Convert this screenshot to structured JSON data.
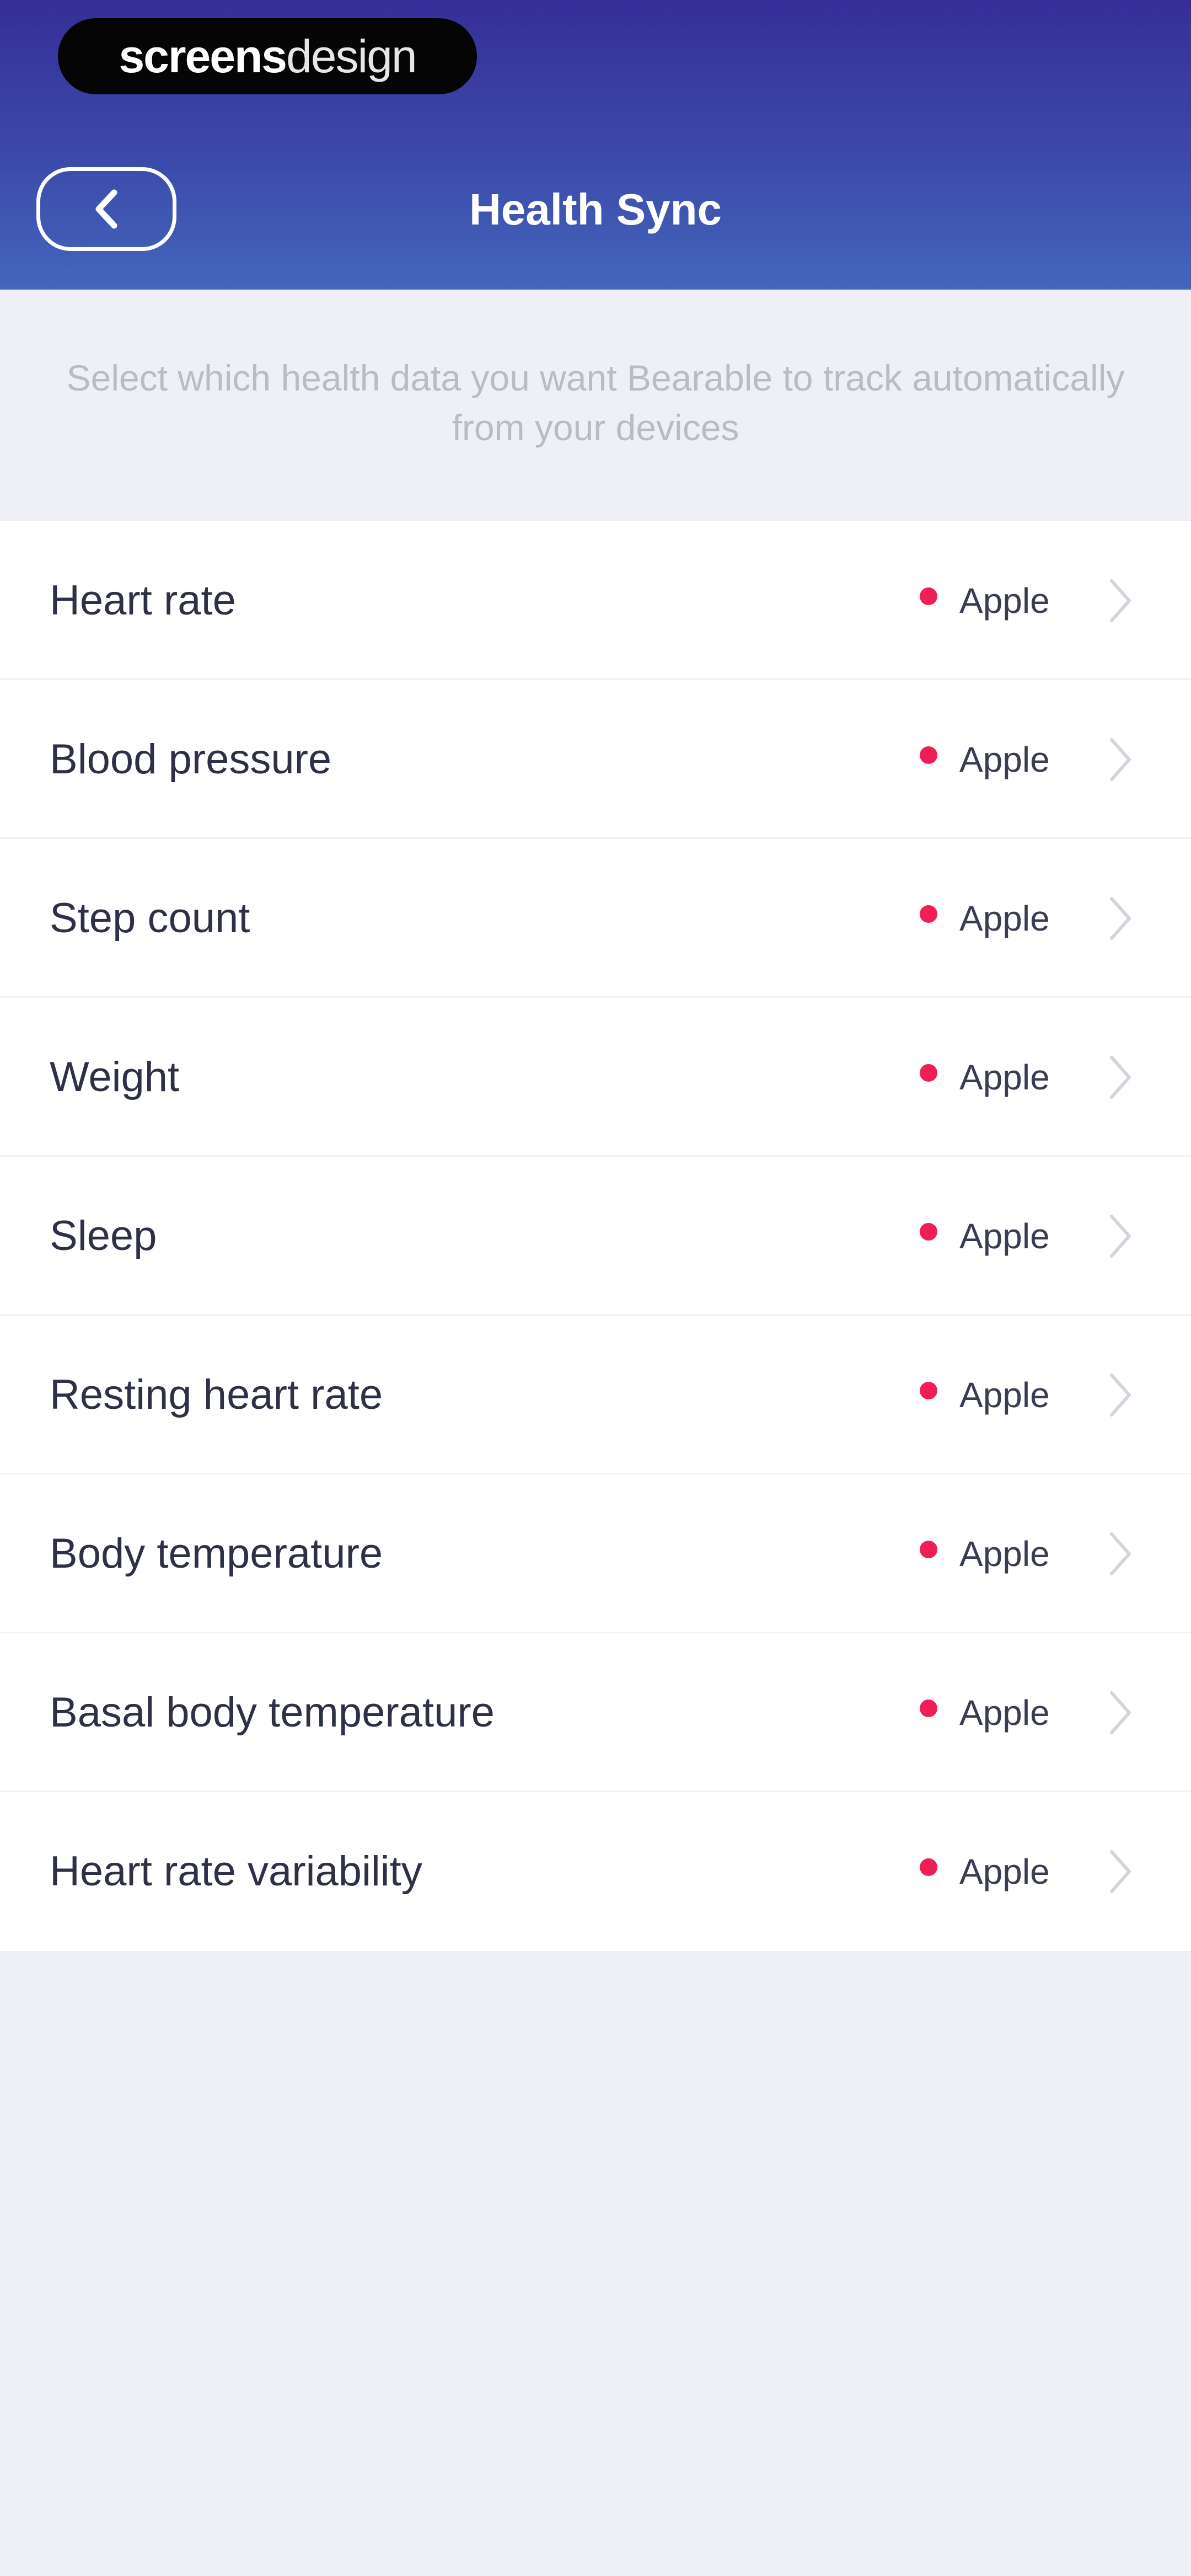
{
  "watermark": {
    "bold": "screens",
    "light": "design"
  },
  "header": {
    "title": "Health Sync",
    "back_icon": "chevron-left-icon"
  },
  "description": "Select which health data you want Bearable to track automatically from your devices",
  "colors": {
    "header_top": "#362e98",
    "header_bottom": "#4466bb",
    "source_dot": "#ef1f56",
    "background": "#eff0f5"
  },
  "items": [
    {
      "label": "Heart rate",
      "source": "Apple"
    },
    {
      "label": "Blood pressure",
      "source": "Apple"
    },
    {
      "label": "Step count",
      "source": "Apple"
    },
    {
      "label": "Weight",
      "source": "Apple"
    },
    {
      "label": "Sleep",
      "source": "Apple"
    },
    {
      "label": "Resting heart rate",
      "source": "Apple"
    },
    {
      "label": "Body temperature",
      "source": "Apple"
    },
    {
      "label": "Basal body temperature",
      "source": "Apple"
    },
    {
      "label": "Heart rate variability",
      "source": "Apple"
    }
  ]
}
